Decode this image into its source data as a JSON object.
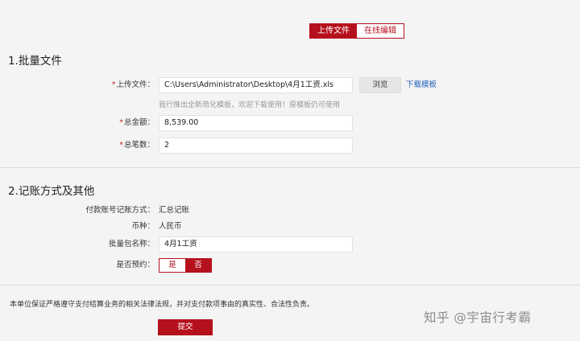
{
  "tabs": [
    {
      "label": "上传文件",
      "active": true
    },
    {
      "label": "在线编辑",
      "active": false
    }
  ],
  "section1": {
    "title": "1.批量文件",
    "upload_label": "上传文件：",
    "upload_value": "C:\\Users\\Administrator\\Desktop\\4月1工资.xls",
    "browse_label": "浏览",
    "template_link": "下载模板",
    "hint": "我行推出全新简化模板，欢迎下载使用！原模板仍可使用",
    "total_amount_label": "总金额：",
    "total_amount_value": "8,539.00",
    "total_count_label": "总笔数：",
    "total_count_value": "2"
  },
  "section2": {
    "title": "2.记账方式及其他",
    "method_label": "付款账号记账方式：",
    "method_value": "汇总记账",
    "currency_label": "币种：",
    "currency_value": "人民币",
    "batch_name_label": "批量包名称：",
    "batch_name_value": "4月1工资",
    "reserve_label": "是否预约：",
    "reserve_options": [
      "是",
      "否"
    ],
    "reserve_selected": "否"
  },
  "required_mark": "*",
  "footer": {
    "statement": "本单位保证严格遵守支付结算业务的相关法律法规，并对支付款项事由的真实性、合法性负责。",
    "submit_label": "提交"
  },
  "watermark": "知乎 @宇宙行考霸",
  "colors": {
    "accent": "#b5111d",
    "link": "#1f5fb8",
    "required": "#c0272d"
  }
}
